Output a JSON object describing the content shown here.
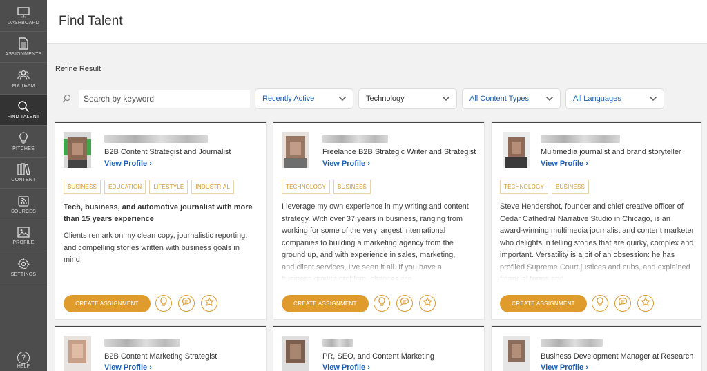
{
  "sidebar": {
    "items": [
      {
        "label": "DASHBOARD",
        "icon": "monitor-icon"
      },
      {
        "label": "ASSIGNMENTS",
        "icon": "document-icon"
      },
      {
        "label": "MY TEAM",
        "icon": "team-icon"
      },
      {
        "label": "FIND TALENT",
        "icon": "search-icon",
        "active": true
      },
      {
        "label": "PITCHES",
        "icon": "lightbulb-icon"
      },
      {
        "label": "CONTENT",
        "icon": "books-icon"
      },
      {
        "label": "SOURCES",
        "icon": "rss-icon"
      },
      {
        "label": "PROFILE",
        "icon": "image-icon"
      },
      {
        "label": "SETTINGS",
        "icon": "gear-icon"
      }
    ],
    "help_label": "HELP"
  },
  "header": {
    "title": "Find Talent"
  },
  "refine": {
    "label": "Refine Result"
  },
  "filters": {
    "search_placeholder": "Search by keyword",
    "activity": "Recently Active",
    "industry": "Technology",
    "content_types": "All Content Types",
    "languages": "All Languages"
  },
  "cards": [
    {
      "role": "B2B Content Strategist and Journalist",
      "view_profile": "View Profile ›",
      "tags": [
        "BUSINESS",
        "EDUCATION",
        "LIFESTYLE",
        "INDUSTRIAL"
      ],
      "headline": "Tech, business, and automotive journalist with more than 15 years experience",
      "description": "Clients remark on my clean copy, journalistic reporting, and compelling stories written with business goals in mind.\n\nMy client list includes the likes of: Cybereason",
      "create_label": "CREATE ASSIGNMENT"
    },
    {
      "role": "Freelance B2B Strategic Writer and Strategist",
      "view_profile": "View Profile ›",
      "tags": [
        "TECHNOLOGY",
        "BUSINESS"
      ],
      "headline": "",
      "description": "I leverage my own experience in my writing and content strategy. With over 37 years in business, ranging from working for some of the very largest international companies to building a marketing agency from the ground up, and with experience in sales, marketing, and client services, I've seen it all. If you have a business growth problem, chances are",
      "create_label": "CREATE ASSIGNMENT"
    },
    {
      "role": "Multimedia journalist and brand storyteller",
      "view_profile": "View Profile ›",
      "tags": [
        "TECHNOLOGY",
        "BUSINESS"
      ],
      "headline": "",
      "description": "Steve Hendershot, founder and chief creative officer of Cedar Cathedral Narrative Studio in Chicago, is an award-winning multimedia journalist and content marketer who delights in telling stories that are quirky, complex and important. Versatility is a bit of an obsession: he has profiled Supreme Court justices and cubs, and explained financial terms and",
      "create_label": "CREATE ASSIGNMENT"
    },
    {
      "role": "B2B Content Marketing Strategist",
      "view_profile": "View Profile ›"
    },
    {
      "role": "PR, SEO, and Content Marketing",
      "view_profile": "View Profile ›"
    },
    {
      "role": "Business Development Manager at Research",
      "view_profile": "View Profile ›"
    }
  ],
  "colors": {
    "accent": "#e09b2d",
    "link": "#1f5fb5",
    "sidebar": "#4d4d4d",
    "sidebar_active": "#333333"
  }
}
